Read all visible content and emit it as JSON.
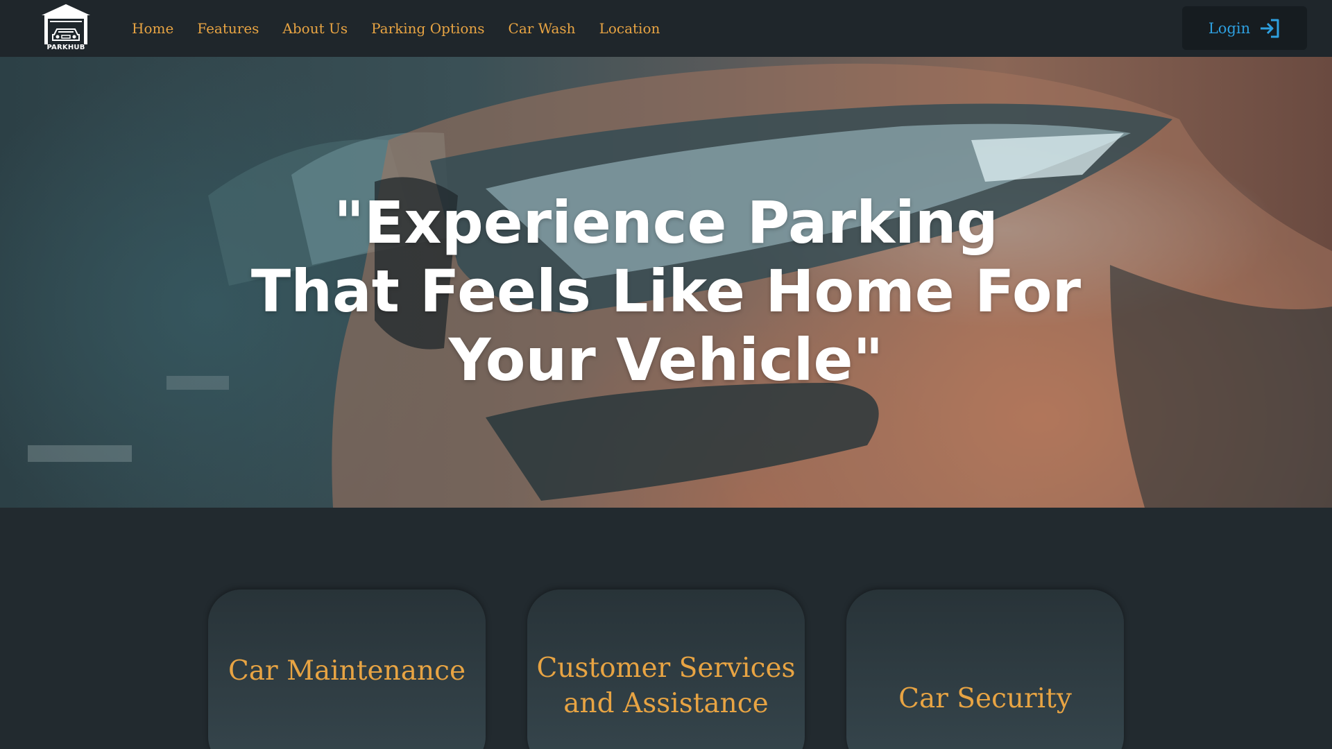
{
  "navbar": {
    "logo_text": "PARKHUB",
    "links": [
      "Home",
      "Features",
      "About Us",
      "Parking Options",
      "Car Wash",
      "Location"
    ],
    "login_label": "Login"
  },
  "hero": {
    "quote": "\"Experience Parking That Feels Like Home For Your Vehicle\""
  },
  "cards": [
    {
      "title": "Car Maintenance"
    },
    {
      "title": "Customer Services and Assistance"
    },
    {
      "title": "Car Security"
    }
  ],
  "colors": {
    "accent": "#e8a443",
    "login": "#2ea0e0",
    "nav_bg": "#1f262b",
    "page_bg": "#222a2f"
  }
}
